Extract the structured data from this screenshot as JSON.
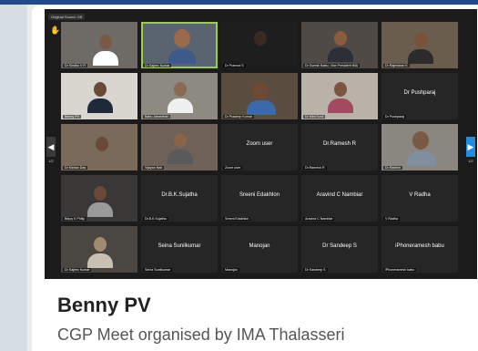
{
  "meeting": {
    "original_sound": "Original Sound: Off",
    "page_left": "1/2",
    "page_right": "1/2"
  },
  "tiles": [
    {
      "caption": "Dr Sindhu V R",
      "label": ""
    },
    {
      "caption": "Dr Sajeev Kumar",
      "label": ""
    },
    {
      "caption": "Dr Pramod S",
      "label": ""
    },
    {
      "caption": "Dr Suresh Babu, Vice President IMA",
      "label": ""
    },
    {
      "caption": "Dr Rajendran K",
      "label": ""
    },
    {
      "caption": "Benny PV",
      "label": ""
    },
    {
      "caption": "Babu Janardhan",
      "label": ""
    },
    {
      "caption": "Dr Pradeep Kumar",
      "label": ""
    },
    {
      "caption": "Dr Mini Sunil",
      "label": ""
    },
    {
      "caption": "Dr Pushparaj",
      "label": "Dr Pushparaj"
    },
    {
      "caption": "Dr Mohan Das",
      "label": ""
    },
    {
      "caption": "Vijayan Nair",
      "label": ""
    },
    {
      "caption": "Zoom user",
      "label": "Zoom user"
    },
    {
      "caption": "Dr.Ramesh R",
      "label": "Dr.Ramesh R"
    },
    {
      "caption": "Dr Rashmi",
      "label": ""
    },
    {
      "caption": "Bejoy K Philip",
      "label": ""
    },
    {
      "caption": "Dr.B.K.Sujatha",
      "label": "Dr.B.K.Sujatha"
    },
    {
      "caption": "Sreeni Edakhlon",
      "label": "Sreeni Edakhlon"
    },
    {
      "caption": "Aravind C Nambiar",
      "label": "Aravind C Nambiar"
    },
    {
      "caption": "V Radha",
      "label": "V Radha"
    },
    {
      "caption": "Dr Sajeev Kumar",
      "label": ""
    },
    {
      "caption": "Seina Sunilkumar",
      "label": "Seina Sunilkumar"
    },
    {
      "caption": "Manojan",
      "label": "Manojan"
    },
    {
      "caption": "Dr Sandeep S",
      "label": "Dr Sandeep S"
    },
    {
      "caption": "iPhoneramesh babu",
      "label": "iPhoneramesh babu"
    }
  ],
  "post": {
    "title": "Benny PV",
    "subtitle": "CGP Meet organised by IMA Thalasseri"
  },
  "colors": {
    "accent_active_speaker": "#9bd13f",
    "nav_arrow_right": "#1f8ee0"
  }
}
